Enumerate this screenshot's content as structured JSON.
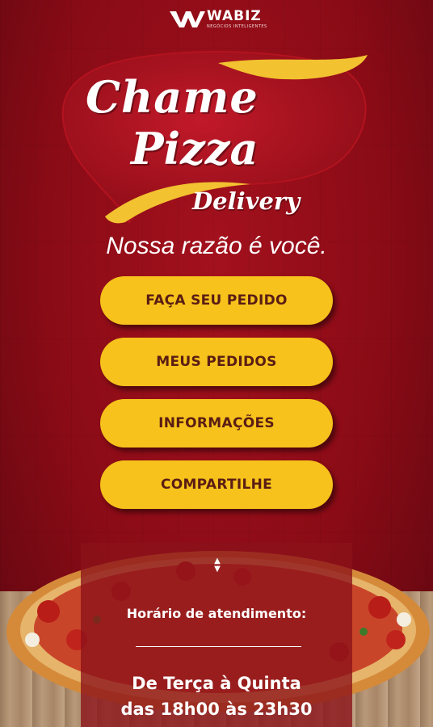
{
  "brand": {
    "icon": "wabiz-logo-icon",
    "name": "WABIZ",
    "tagline": "NEGÓCIOS INTELIGENTES"
  },
  "logo": {
    "line1": "Chame",
    "line2": "Pizza",
    "line3": "Delivery"
  },
  "slogan": "Nossa razão é você.",
  "menu": [
    {
      "label": "FAÇA SEU PEDIDO"
    },
    {
      "label": "MEUS PEDIDOS"
    },
    {
      "label": "INFORMAÇÕES"
    },
    {
      "label": "COMPARTILHE"
    }
  ],
  "hours": {
    "title": "Horário de atendimento:",
    "line1": "De Terça à Quinta",
    "line2": "das 18h00 às 23h30"
  },
  "colors": {
    "background": "#8a0b16",
    "button": "#f6c21b",
    "button_text": "#5a1d14",
    "swoosh": "#f2c230"
  }
}
